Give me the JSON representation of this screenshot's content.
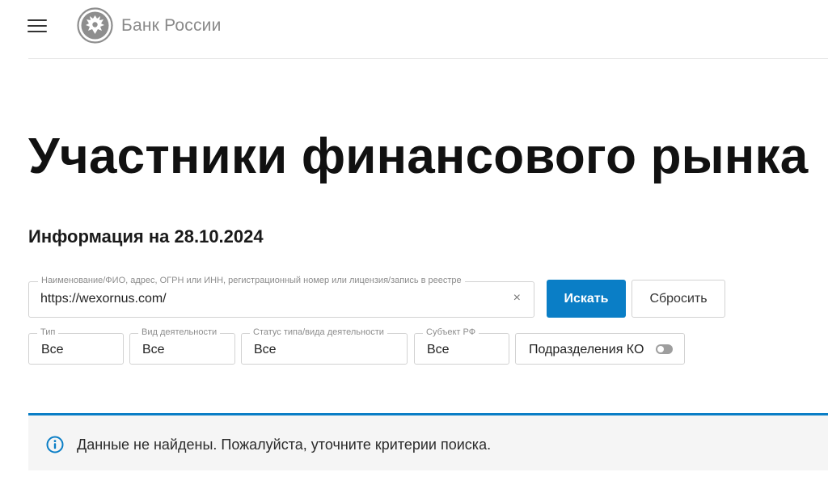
{
  "header": {
    "logo_text": "Банк России",
    "menu_icon": "hamburger-menu-icon",
    "logo_icon": "double-headed-eagle-emblem-icon"
  },
  "page": {
    "title": "Участники финансового рынка",
    "info_date": "Информация на 28.10.2024"
  },
  "search": {
    "label": "Наименование/ФИО, адрес, ОГРН или ИНН, регистрационный номер или лицензия/запись в реестре",
    "value": "https://wexornus.com/",
    "clear_icon": "×",
    "submit_label": "Искать",
    "reset_label": "Сбросить"
  },
  "filters": {
    "type": {
      "label": "Тип",
      "value": "Все"
    },
    "activity": {
      "label": "Вид деятельности",
      "value": "Все"
    },
    "status": {
      "label": "Статус типа/вида деятельности",
      "value": "Все"
    },
    "region": {
      "label": "Субъект РФ",
      "value": "Все"
    },
    "ko_toggle": {
      "label": "Подразделения КО",
      "checked": false
    }
  },
  "notice": {
    "icon": "info-icon",
    "text": "Данные не найдены. Пожалуйста, уточните критерии поиска."
  },
  "colors": {
    "accent": "#0a7ec6",
    "notice_background": "#f5f5f5",
    "toggle_off": "#9e9e9e"
  }
}
